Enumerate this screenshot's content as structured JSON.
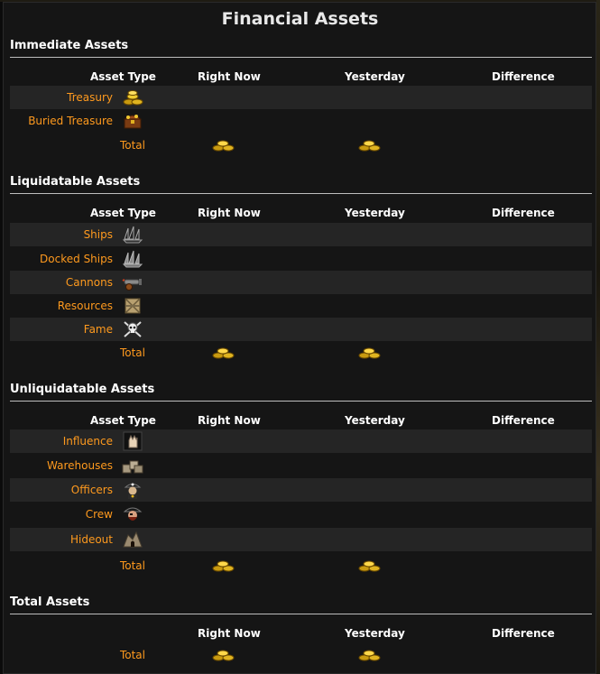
{
  "page_title": "Financial Assets",
  "columns": {
    "asset_type": "Asset Type",
    "right_now": "Right Now",
    "yesterday": "Yesterday",
    "difference": "Difference"
  },
  "sections": [
    {
      "title": "Immediate Assets",
      "items": [
        {
          "label": "Treasury",
          "icon": "gold-coins-icon"
        },
        {
          "label": "Buried Treasure",
          "icon": "treasure-chest-icon"
        }
      ],
      "total_label": "Total"
    },
    {
      "title": "Liquidatable Assets",
      "items": [
        {
          "label": "Ships",
          "icon": "ships-icon"
        },
        {
          "label": "Docked Ships",
          "icon": "docked-ships-icon"
        },
        {
          "label": "Cannons",
          "icon": "cannon-icon"
        },
        {
          "label": "Resources",
          "icon": "crate-icon"
        },
        {
          "label": "Fame",
          "icon": "skull-crossbones-icon"
        }
      ],
      "total_label": "Total"
    },
    {
      "title": "Unliquidatable Assets",
      "items": [
        {
          "label": "Influence",
          "icon": "fist-icon"
        },
        {
          "label": "Warehouses",
          "icon": "warehouse-icon"
        },
        {
          "label": "Officers",
          "icon": "officer-icon"
        },
        {
          "label": "Crew",
          "icon": "pirate-crew-icon"
        },
        {
          "label": "Hideout",
          "icon": "hideout-icon"
        }
      ],
      "total_label": "Total"
    },
    {
      "title": "Total Assets",
      "items": [],
      "total_label": "Total"
    }
  ],
  "colors": {
    "link": "#ff9a1e",
    "background": "#151515",
    "alt_row": "#252525",
    "gold": "#e8c020"
  }
}
